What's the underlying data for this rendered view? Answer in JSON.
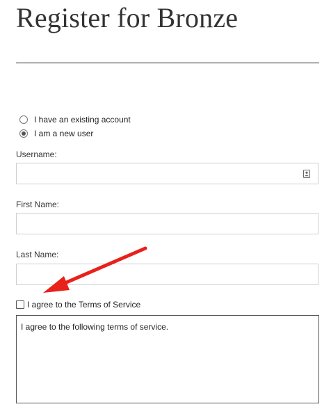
{
  "page": {
    "title": "Register for Bronze"
  },
  "account_type": {
    "options": [
      {
        "label": "I have an existing account",
        "selected": false
      },
      {
        "label": "I am a new user",
        "selected": true
      }
    ]
  },
  "form": {
    "username_label": "Username:",
    "username_value": "",
    "first_name_label": "First Name:",
    "first_name_value": "",
    "last_name_label": "Last Name:",
    "last_name_value": ""
  },
  "terms": {
    "checkbox_label": "I agree to the Terms of Service",
    "checked": false,
    "text": "I agree to the following terms of service."
  },
  "annotation": {
    "arrow_color": "#e8211b"
  },
  "icons": {
    "username_field_icon": "contact-card-icon"
  }
}
